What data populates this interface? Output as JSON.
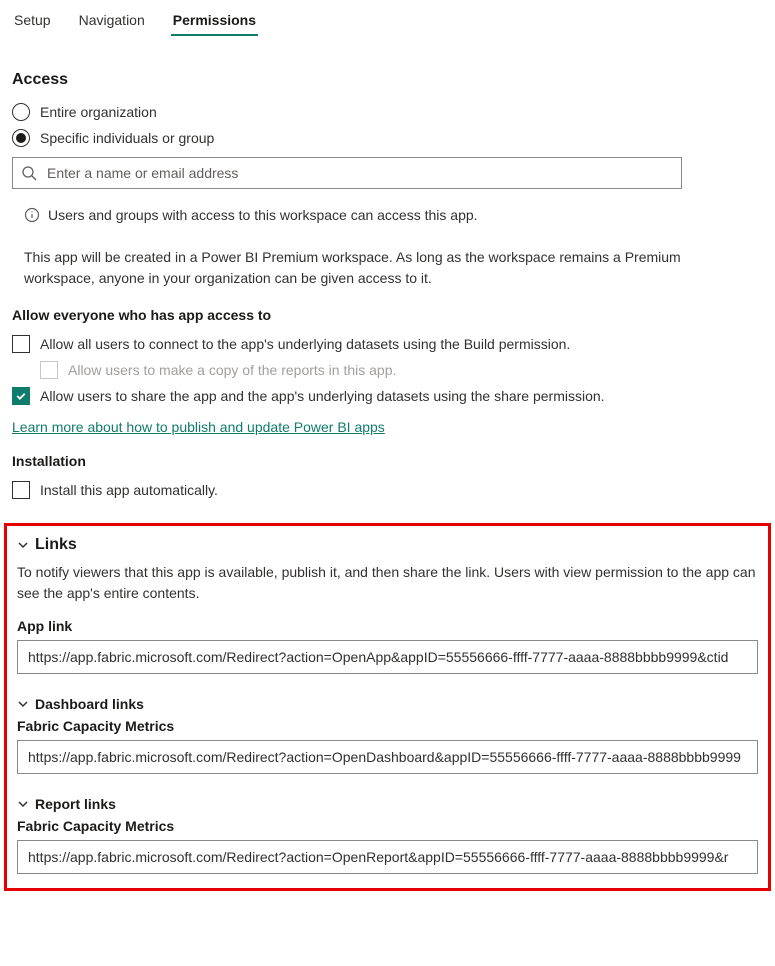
{
  "tabs": {
    "setup": "Setup",
    "navigation": "Navigation",
    "permissions": "Permissions"
  },
  "access": {
    "title": "Access",
    "entire_org": "Entire organization",
    "specific": "Specific individuals or group",
    "search_placeholder": "Enter a name or email address",
    "info": "Users and groups with access to this workspace can access this app.",
    "premium_note": "This app will be created in a Power BI Premium workspace. As long as the workspace remains a Premium workspace, anyone in your organization can be given access to it."
  },
  "allow": {
    "title": "Allow everyone who has app access to",
    "connect": "Allow all users to connect to the app's underlying datasets using the Build permission.",
    "copy": "Allow users to make a copy of the reports in this app.",
    "share": "Allow users to share the app and the app's underlying datasets using the share permission.",
    "learn_more": "Learn more about how to publish and update Power BI apps"
  },
  "installation": {
    "title": "Installation",
    "auto": "Install this app automatically."
  },
  "links": {
    "title": "Links",
    "desc": "To notify viewers that this app is available, publish it, and then share the link. Users with view permission to the app can see the app's entire contents.",
    "app_link_label": "App link",
    "app_link_value": "https://app.fabric.microsoft.com/Redirect?action=OpenApp&appID=55556666-ffff-7777-aaaa-8888bbbb9999&ctid",
    "dashboard_links_label": "Dashboard links",
    "dashboard_item_label": "Fabric Capacity Metrics",
    "dashboard_link_value": "https://app.fabric.microsoft.com/Redirect?action=OpenDashboard&appID=55556666-ffff-7777-aaaa-8888bbbb9999",
    "report_links_label": "Report links",
    "report_item_label": "Fabric Capacity Metrics",
    "report_link_value": "https://app.fabric.microsoft.com/Redirect?action=OpenReport&appID=55556666-ffff-7777-aaaa-8888bbbb9999&r"
  }
}
